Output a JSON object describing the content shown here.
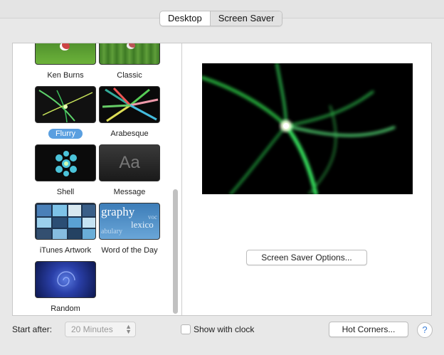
{
  "tabs": [
    {
      "label": "Desktop",
      "selected": false
    },
    {
      "label": "Screen Saver",
      "selected": true
    }
  ],
  "screensavers": [
    {
      "label": "Ken Burns",
      "selected": false
    },
    {
      "label": "Classic",
      "selected": false
    },
    {
      "label": "Flurry",
      "selected": true
    },
    {
      "label": "Arabesque",
      "selected": false
    },
    {
      "label": "Shell",
      "selected": false
    },
    {
      "label": "Message",
      "selected": false,
      "thumb_text": "Aa"
    },
    {
      "label": "iTunes Artwork",
      "selected": false
    },
    {
      "label": "Word of the Day",
      "selected": false,
      "thumb_words": [
        "graphy",
        "lexico",
        "abulary",
        "voc"
      ]
    },
    {
      "label": "Random",
      "selected": false
    }
  ],
  "preview": {
    "options_button": "Screen Saver Options..."
  },
  "footer": {
    "start_after_label": "Start after:",
    "start_after_value": "20 Minutes",
    "show_clock_label": "Show with clock",
    "show_clock_checked": false,
    "hot_corners_button": "Hot Corners...",
    "help_label": "?"
  },
  "colors": {
    "selection": "#5a9fe0",
    "flurry_green": "#3cff6a"
  }
}
